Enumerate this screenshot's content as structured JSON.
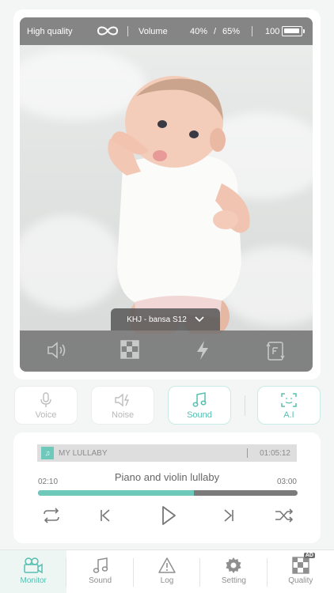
{
  "status_bar": {
    "quality": "High quality",
    "volume_label": "Volume",
    "volume_left": "40%",
    "volume_divider": "/",
    "volume_right": "65%",
    "battery_level": "100",
    "battery_fraction": 1.0
  },
  "video": {
    "device_name": "KHJ - bansa S12",
    "controls": [
      "speaker-icon",
      "mosaic-icon",
      "flash-icon",
      "camera-switch-icon"
    ]
  },
  "modes": [
    {
      "label": "Voice",
      "icon": "microphone-icon",
      "active": false
    },
    {
      "label": "Noise",
      "icon": "noise-icon",
      "active": false
    },
    {
      "label": "Sound",
      "icon": "music-note-icon",
      "active": true
    },
    {
      "label": "A.I",
      "icon": "face-scan-icon",
      "active": true
    }
  ],
  "player": {
    "playlist_name": "MY LULLABY",
    "playlist_duration": "01:05:12",
    "track_title": "Piano and violin lullaby",
    "current_time": "02:10",
    "total_time": "03:00",
    "progress": 0.6
  },
  "tabs": [
    {
      "label": "Monitor",
      "icon": "camera-icon",
      "active": true
    },
    {
      "label": "Sound",
      "icon": "music-note-icon",
      "active": false
    },
    {
      "label": "Log",
      "icon": "warning-icon",
      "active": false
    },
    {
      "label": "Setting",
      "icon": "gear-icon",
      "active": false
    },
    {
      "label": "Quality",
      "icon": "quality-icon",
      "active": false,
      "badge": "AD"
    }
  ],
  "colors": {
    "accent": "#6fc9bb",
    "accent_text": "#58bfb1",
    "overlay": "#6e6e6e"
  }
}
